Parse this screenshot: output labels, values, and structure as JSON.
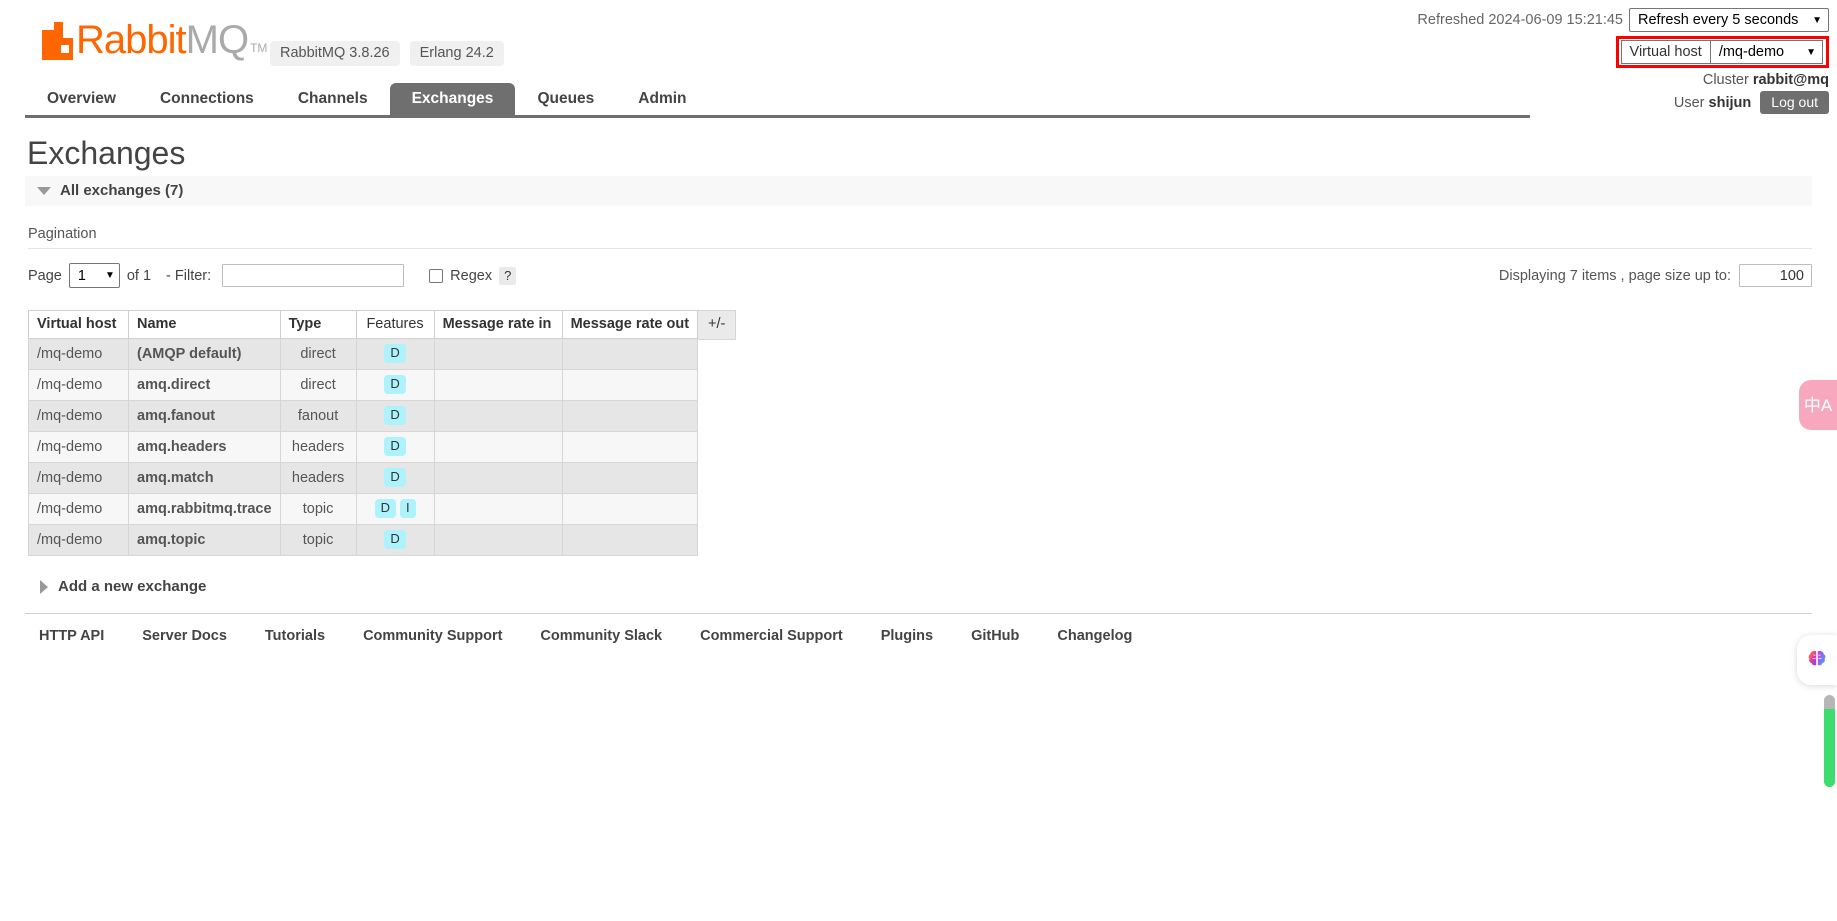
{
  "brand": {
    "name_rabbit": "Rabbit",
    "name_mq": "MQ",
    "tm": "TM",
    "logo_icon": "rabbitmq-logo-icon",
    "accent_color": "#ff6600"
  },
  "version_badges": [
    {
      "label": "RabbitMQ 3.8.26"
    },
    {
      "label": "Erlang 24.2"
    }
  ],
  "top_right": {
    "refreshed_text": "Refreshed 2024-06-09 15:21:45",
    "refresh_select_value": "Refresh every 5 seconds",
    "vhost_label": "Virtual host",
    "vhost_value": "/mq-demo",
    "vhost_highlight_color": "#ff0000",
    "cluster_label": "Cluster",
    "cluster_value": "rabbit@mq",
    "user_label": "User",
    "user_value": "shijun",
    "logout_label": "Log out"
  },
  "nav": {
    "items": [
      {
        "label": "Overview",
        "active": false
      },
      {
        "label": "Connections",
        "active": false
      },
      {
        "label": "Channels",
        "active": false
      },
      {
        "label": "Exchanges",
        "active": true
      },
      {
        "label": "Queues",
        "active": false
      },
      {
        "label": "Admin",
        "active": false
      }
    ]
  },
  "main": {
    "page_title": "Exchanges",
    "section_title": "All exchanges (7)",
    "pagination_label": "Pagination",
    "page_label": "Page",
    "page_value": "1",
    "of_label": "of 1",
    "filter_label": "- Filter:",
    "filter_value": "",
    "regex_label": "Regex",
    "help_label": "?",
    "displaying_text": "Displaying 7 items , page size up to:",
    "page_size_value": "100",
    "plus_minus_label": "+/-",
    "add_exchange_label": "Add a new exchange"
  },
  "table": {
    "headers": {
      "vhost": "Virtual host",
      "name": "Name",
      "type": "Type",
      "features": "Features",
      "rate_in": "Message rate in",
      "rate_out": "Message rate out"
    },
    "rows": [
      {
        "vhost": "/mq-demo",
        "name": "(AMQP default)",
        "type": "direct",
        "features": [
          "D"
        ],
        "rate_in": "",
        "rate_out": ""
      },
      {
        "vhost": "/mq-demo",
        "name": "amq.direct",
        "type": "direct",
        "features": [
          "D"
        ],
        "rate_in": "",
        "rate_out": ""
      },
      {
        "vhost": "/mq-demo",
        "name": "amq.fanout",
        "type": "fanout",
        "features": [
          "D"
        ],
        "rate_in": "",
        "rate_out": ""
      },
      {
        "vhost": "/mq-demo",
        "name": "amq.headers",
        "type": "headers",
        "features": [
          "D"
        ],
        "rate_in": "",
        "rate_out": ""
      },
      {
        "vhost": "/mq-demo",
        "name": "amq.match",
        "type": "headers",
        "features": [
          "D"
        ],
        "rate_in": "",
        "rate_out": ""
      },
      {
        "vhost": "/mq-demo",
        "name": "amq.rabbitmq.trace",
        "type": "topic",
        "features": [
          "D",
          "I"
        ],
        "rate_in": "",
        "rate_out": ""
      },
      {
        "vhost": "/mq-demo",
        "name": "amq.topic",
        "type": "topic",
        "features": [
          "D"
        ],
        "rate_in": "",
        "rate_out": ""
      }
    ]
  },
  "footer": {
    "links": [
      "HTTP API",
      "Server Docs",
      "Tutorials",
      "Community Support",
      "Community Slack",
      "Commercial Support",
      "Plugins",
      "GitHub",
      "Changelog"
    ]
  },
  "widgets": {
    "translate_glyph": "中A",
    "translate_color": "#f7a8bf",
    "brain_icon": "brain-icon"
  }
}
